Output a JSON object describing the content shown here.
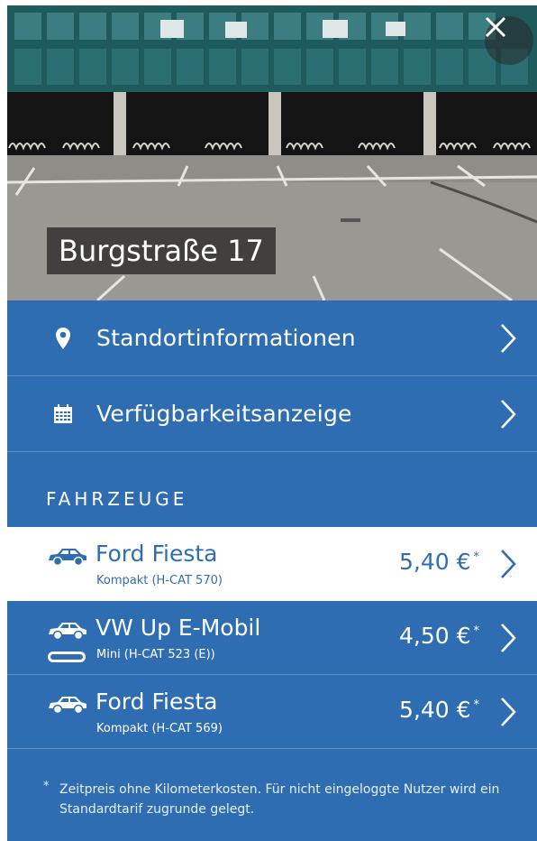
{
  "location": {
    "title": "Burgstraße 17"
  },
  "nav": [
    {
      "label": "Standortinformationen",
      "icon": "map-pin-icon"
    },
    {
      "label": "Verfügbarkeitsanzeige",
      "icon": "calendar-icon"
    }
  ],
  "vehicles_section": {
    "heading": "FAHRZEUGE"
  },
  "vehicles": [
    {
      "name": "Ford Fiesta",
      "class": "Kompakt (H-CAT 570)",
      "price": "5,40 €",
      "asterisk": "*",
      "selected": true,
      "electric": false
    },
    {
      "name": "VW Up E-Mobil",
      "class": "Mini (H-CAT 523 (E))",
      "price": "4,50 €",
      "asterisk": "*",
      "selected": false,
      "electric": true
    },
    {
      "name": "Ford Fiesta",
      "class": "Kompakt (H-CAT 569)",
      "price": "5,40 €",
      "asterisk": "*",
      "selected": false,
      "electric": false
    }
  ],
  "footnote": {
    "asterisk": "*",
    "text": "Zeitpreis ohne Kilometerkosten. Für nicht eingeloggte Nutzer wird ein Standardtarif zugrunde gelegt."
  },
  "colors": {
    "primary": "#2f6db3",
    "selected_bg": "#ffffff",
    "text_light": "#ffffff"
  }
}
